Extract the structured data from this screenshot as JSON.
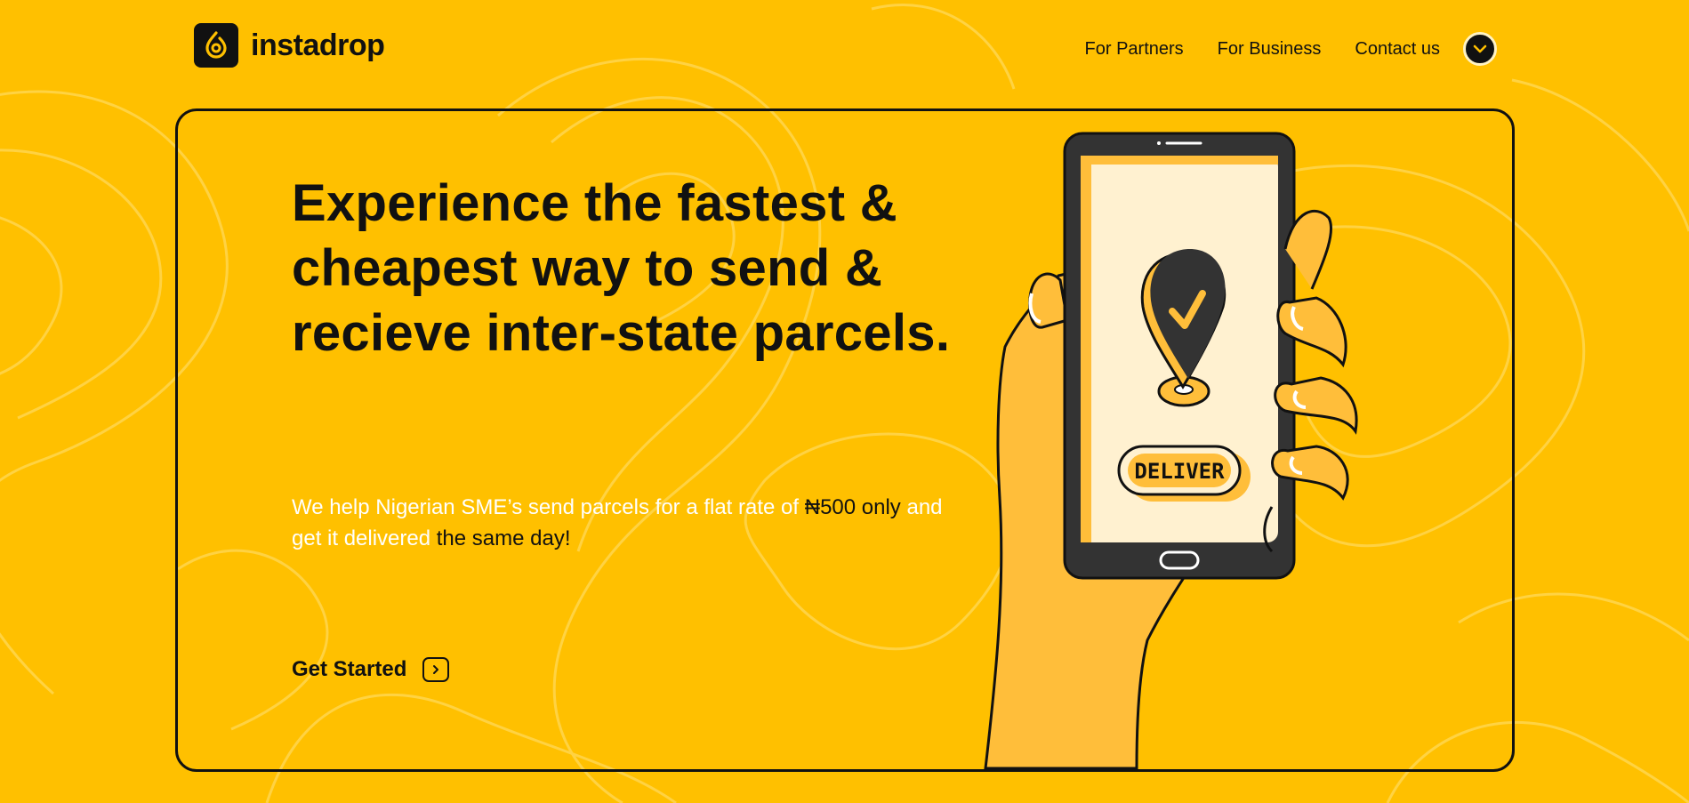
{
  "brand": {
    "name": "instadrop",
    "colors": {
      "background": "#FFC000",
      "ink": "#111111",
      "highlight": "#FFFFFF",
      "phone_screen": "#FFF1D0",
      "hand": "#FFBE3A"
    }
  },
  "nav": {
    "items": [
      {
        "label": "For Partners"
      },
      {
        "label": "For Business"
      },
      {
        "label": "Contact us"
      }
    ],
    "toggle_icon": "chevron-down-icon"
  },
  "hero": {
    "headline": "Experience the fastest & cheapest way to send & recieve inter-state parcels.",
    "subtext": {
      "part1": "We help Nigerian SME’s send parcels for a flat rate of ",
      "price": "₦500",
      "part2": " only ",
      "part3": "and get it delivered",
      "part4": " the same day!"
    },
    "cta_label": "Get Started",
    "cta_icon": "chevron-right-icon"
  },
  "illustration": {
    "deliver_label": "DELIVER",
    "pin_icon": "map-pin-check-icon"
  }
}
